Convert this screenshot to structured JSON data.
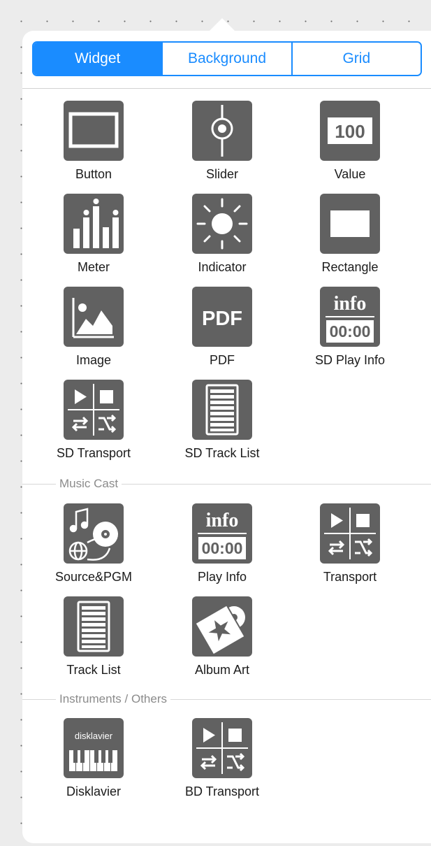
{
  "tabs": [
    {
      "label": "Widget",
      "selected": true
    },
    {
      "label": "Background",
      "selected": false
    },
    {
      "label": "Grid",
      "selected": false
    }
  ],
  "widgets": {
    "button": {
      "label": "Button",
      "icon": "button-frame-icon"
    },
    "slider": {
      "label": "Slider",
      "icon": "slider-icon"
    },
    "value": {
      "label": "Value",
      "icon": "value-100-icon",
      "icon_text": "100"
    },
    "meter": {
      "label": "Meter",
      "icon": "meter-bars-icon"
    },
    "indicator": {
      "label": "Indicator",
      "icon": "sun-indicator-icon"
    },
    "rectangle": {
      "label": "Rectangle",
      "icon": "rectangle-icon"
    },
    "image": {
      "label": "Image",
      "icon": "image-icon"
    },
    "pdf": {
      "label": "PDF",
      "icon": "pdf-icon",
      "icon_text": "PDF"
    },
    "sd_play_info": {
      "label": "SD Play Info",
      "icon": "play-info-icon",
      "icon_top": "info",
      "icon_bottom": "00:00"
    },
    "sd_transport": {
      "label": "SD Transport",
      "icon": "transport-icon"
    },
    "sd_track_list": {
      "label": "SD Track List",
      "icon": "track-list-icon"
    }
  },
  "sections": {
    "music_cast": "Music Cast",
    "instruments": "Instruments / Others"
  },
  "music_cast": {
    "source_pgm": {
      "label": "Source&PGM",
      "icon": "source-music-globe-icon"
    },
    "play_info": {
      "label": "Play Info",
      "icon": "play-info-icon",
      "icon_top": "info",
      "icon_bottom": "00:00"
    },
    "transport": {
      "label": "Transport",
      "icon": "transport-icon"
    },
    "track_list": {
      "label": "Track List",
      "icon": "track-list-icon"
    },
    "album_art": {
      "label": "Album Art",
      "icon": "album-art-icon"
    }
  },
  "instruments": {
    "disklavier": {
      "label": "Disklavier",
      "icon": "disklavier-piano-icon",
      "icon_text": "disklavier"
    },
    "bd_transport": {
      "label": "BD Transport",
      "icon": "transport-icon"
    }
  },
  "colors": {
    "accent": "#1a8cff",
    "tile": "#616161",
    "section_text": "#8b8b8b"
  }
}
